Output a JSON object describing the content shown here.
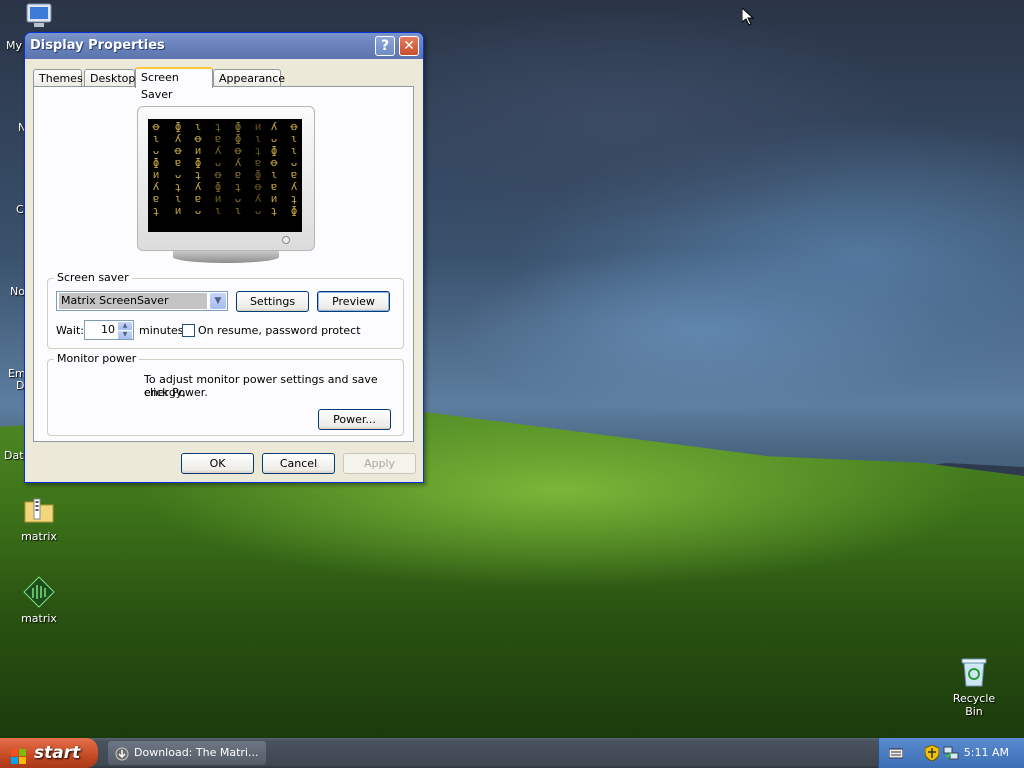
{
  "desktop": {
    "icons": [
      {
        "label": "matrix"
      },
      {
        "label": "matrix"
      },
      {
        "label": "Recycle Bin"
      }
    ],
    "edge_labels": [
      "My",
      "N",
      "C",
      "No",
      "Em",
      "D",
      "Data"
    ]
  },
  "window": {
    "title": "Display Properties",
    "help_label": "?",
    "close_label": "✕",
    "tabs": [
      {
        "label": "Themes"
      },
      {
        "label": "Desktop"
      },
      {
        "label": "Screen Saver"
      },
      {
        "label": "Appearance"
      }
    ],
    "monitor_glyphs": [
      "ꝋ",
      "ɩ",
      "ᴗ",
      "ɸ",
      "ᴎ",
      "ʎ",
      "ɐ",
      "ʇ"
    ],
    "screen_saver": {
      "legend": "Screen saver",
      "selected": "Matrix ScreenSaver",
      "settings_label": "Settings",
      "preview_label": "Preview",
      "wait_label": "Wait:",
      "wait_value": "10",
      "minutes_label": "minutes",
      "password_label": "On resume, password protect"
    },
    "monitor_power": {
      "legend": "Monitor power",
      "description_line1": "To adjust monitor power settings and save energy,",
      "description_line2": "click Power.",
      "power_label": "Power..."
    },
    "buttons": {
      "ok": "OK",
      "cancel": "Cancel",
      "apply": "Apply"
    }
  },
  "taskbar": {
    "start_label": "start",
    "task_item": "Download: The Matri...",
    "clock": "5:11 AM"
  },
  "colors": {
    "window_border": "#0831d9",
    "tab_active_accent": "#ffc83c",
    "matrix_glyph": "#c8a844"
  }
}
